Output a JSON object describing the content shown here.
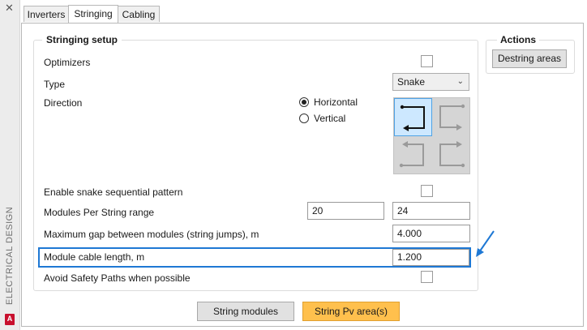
{
  "sidebar": {
    "close_glyph": "✕",
    "vertical_title": "ELECTRICAL DESIGN",
    "logo_letter": "A"
  },
  "tabs": [
    {
      "label": "Inverters",
      "active": false
    },
    {
      "label": "Stringing",
      "active": true
    },
    {
      "label": "Cabling",
      "active": false
    }
  ],
  "stringing_setup": {
    "title": "Stringing setup",
    "optimizers": {
      "label": "Optimizers",
      "checked": false
    },
    "type": {
      "label": "Type",
      "value": "Snake"
    },
    "direction": {
      "label": "Direction",
      "options": [
        {
          "label": "Horizontal",
          "selected": true
        },
        {
          "label": "Vertical",
          "selected": false
        }
      ],
      "selected_pattern": "top-left"
    },
    "snake_sequential": {
      "label": "Enable snake sequential pattern",
      "checked": false
    },
    "modules_per_string": {
      "label": "Modules Per String range",
      "min": "20",
      "max": "24"
    },
    "max_gap": {
      "label": "Maximum gap between modules (string jumps), m",
      "value": "4.000"
    },
    "module_cable_length": {
      "label": "Module cable length, m",
      "value": "1.200"
    },
    "avoid_safety_paths": {
      "label": "Avoid Safety Paths when possible",
      "checked": false
    }
  },
  "actions": {
    "title": "Actions",
    "destring_label": "Destring areas"
  },
  "footer": {
    "string_modules_label": "String modules",
    "string_pv_label": "String Pv area(s)"
  },
  "colors": {
    "highlight": "#1e78d4",
    "accent_button": "#ffc04d",
    "selected_cell": "#cde8ff"
  }
}
